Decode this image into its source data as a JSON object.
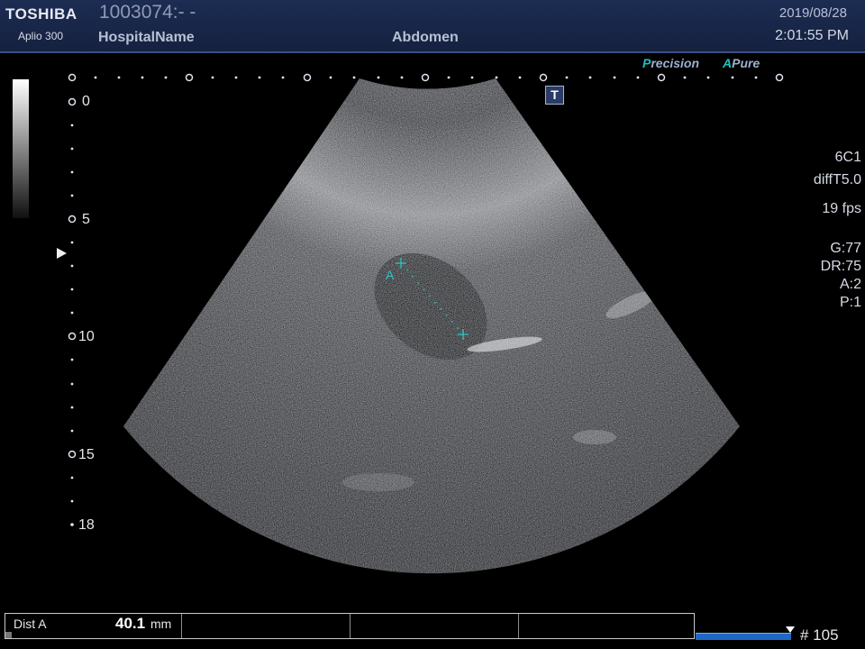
{
  "header": {
    "brand": "TOSHIBA",
    "model": "Aplio 300",
    "patient_id": "1003074:- -",
    "hospital": "HospitalName",
    "preset": "Abdomen",
    "date": "2019/08/28",
    "time": "2:01:55 PM"
  },
  "badges": {
    "precision_letter": "P",
    "precision_rest": "recision",
    "apure_letter": "A",
    "apure_rest": "Pure"
  },
  "depth_scale": {
    "labels": [
      "0",
      "5",
      "10",
      "15",
      "18"
    ]
  },
  "icons": {
    "tgc": "T",
    "focus": "focus-marker-icon"
  },
  "imaging_params": {
    "transducer": "6C1",
    "harmonic": "diffT5.0",
    "frame_rate": "19 fps",
    "gain": "G:77",
    "dynamic_range": "DR:75",
    "a_value": "A:2",
    "p_value": "P:1"
  },
  "measurement": {
    "cursor_label": "A",
    "name": "Dist A",
    "value": "40.1",
    "unit": "mm"
  },
  "cine": {
    "frame": "# 105"
  },
  "colors": {
    "header_bg": "#1c2c52",
    "caliper": "#2ec4c4",
    "cine_bar": "#1f68c7"
  }
}
